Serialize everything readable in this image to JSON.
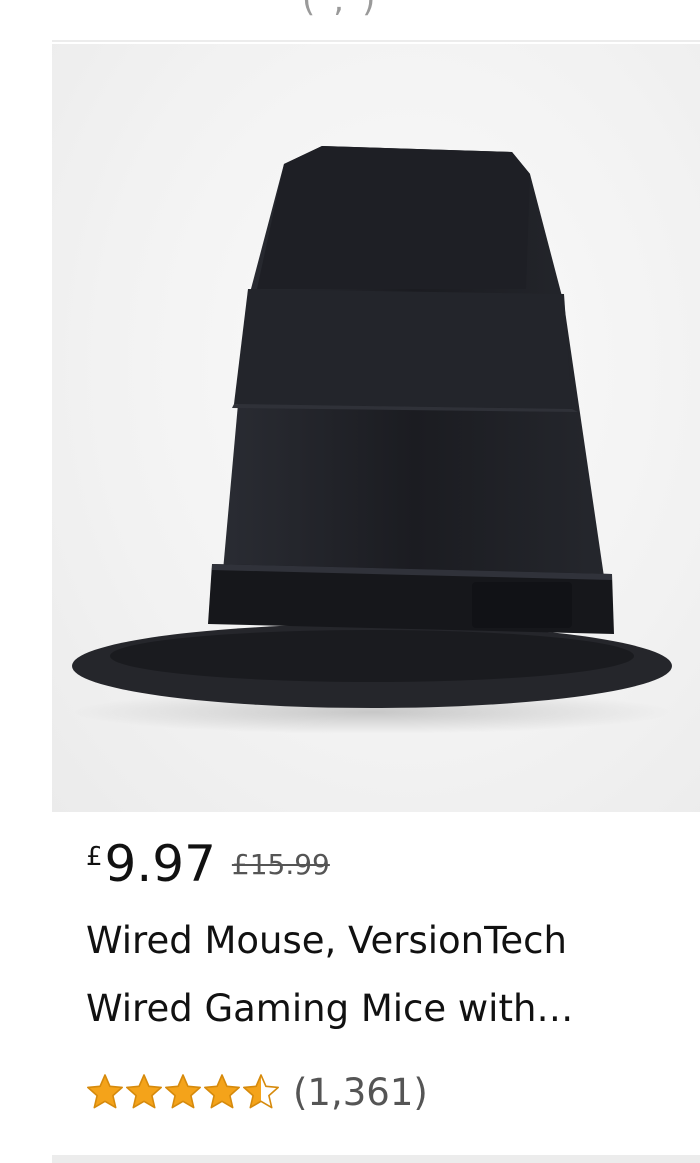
{
  "top_card": {
    "partial_text": "(,)"
  },
  "product": {
    "image_icon": "top-hat-image",
    "currency_symbol": "£",
    "price": "9.97",
    "list_price": "£15.99",
    "title_line_1": "Wired Mouse, VersionTech",
    "title_line_2": "Wired Gaming Mice with…",
    "rating": 4.5,
    "rating_max": 5,
    "review_count": "(1,361)",
    "star_color": "#f4a31a"
  }
}
